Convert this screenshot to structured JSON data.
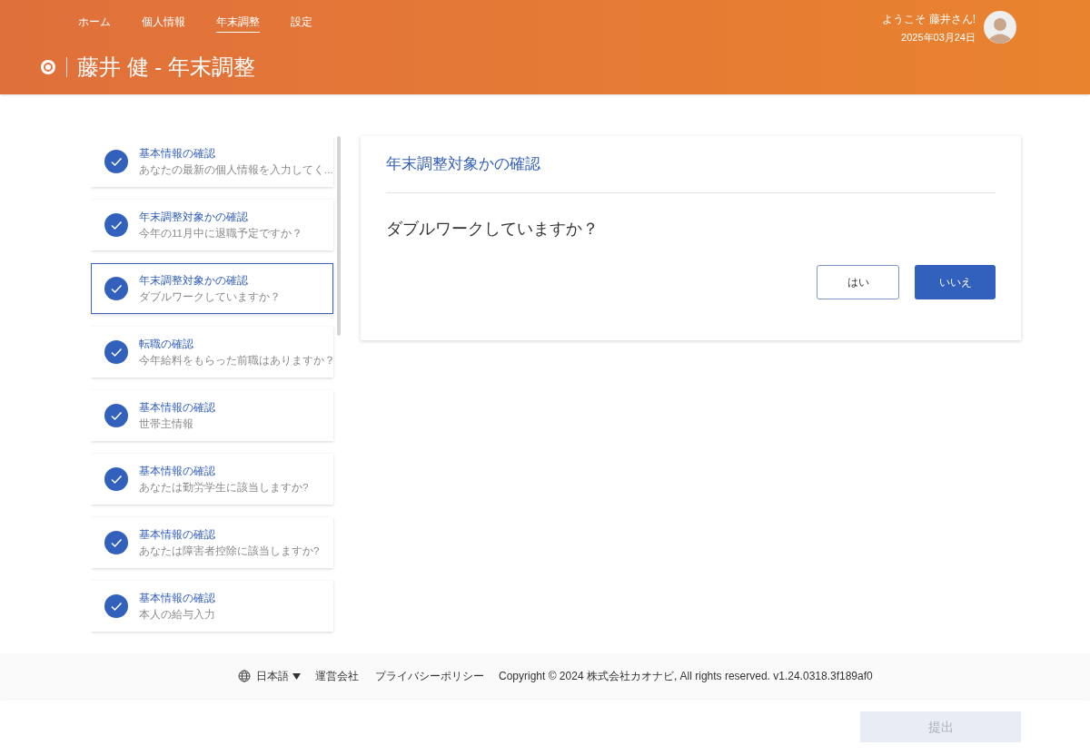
{
  "nav": [
    {
      "label": "ホーム",
      "selected": false
    },
    {
      "label": "個人情報",
      "selected": false
    },
    {
      "label": "年末調整",
      "selected": true
    },
    {
      "label": "設定",
      "selected": false
    }
  ],
  "page_title": "藤井 健 - 年末調整",
  "user": {
    "greeting": "ようこそ 藤井さん!",
    "date": "2025年03月24日"
  },
  "steps": [
    {
      "title": "基本情報の確認",
      "subtitle": "あなたの最新の個人情報を入力してく...",
      "done": true,
      "selected": false
    },
    {
      "title": "年末調整対象かの確認",
      "subtitle": "今年の11月中に退職予定ですか？",
      "done": true,
      "selected": false
    },
    {
      "title": "年末調整対象かの確認",
      "subtitle": "ダブルワークしていますか？",
      "done": true,
      "selected": true
    },
    {
      "title": "転職の確認",
      "subtitle": "今年給料をもらった前職はありますか？",
      "done": true,
      "selected": false
    },
    {
      "title": "基本情報の確認",
      "subtitle": "世帯主情報",
      "done": true,
      "selected": false
    },
    {
      "title": "基本情報の確認",
      "subtitle": "あなたは勤労学生に該当しますか?",
      "done": true,
      "selected": false
    },
    {
      "title": "基本情報の確認",
      "subtitle": "あなたは障害者控除に該当しますか?",
      "done": true,
      "selected": false
    },
    {
      "title": "基本情報の確認",
      "subtitle": "本人の給与入力",
      "done": true,
      "selected": false
    }
  ],
  "question_card": {
    "heading": "年末調整対象かの確認",
    "question": "ダブルワークしていますか？",
    "answers": [
      {
        "label": "はい",
        "selected": false
      },
      {
        "label": "いいえ",
        "selected": true
      }
    ]
  },
  "footer": {
    "language": "日本語",
    "links": [
      "運営会社",
      "プライバシーポリシー"
    ],
    "copyright": "Copyright © 2024 株式会社カオナビ, All rights reserved. v1.24.0318.3f189af0"
  },
  "submit": {
    "label": "提出",
    "disabled": true
  }
}
